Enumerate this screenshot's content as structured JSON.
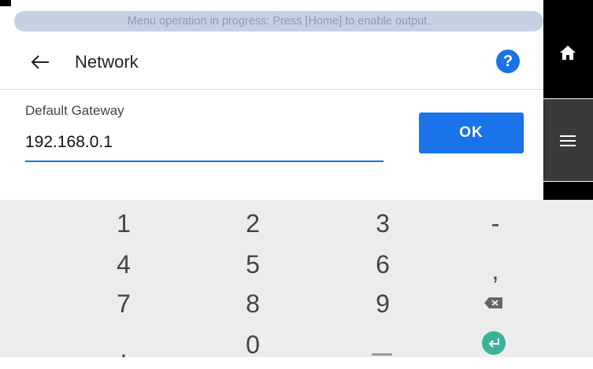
{
  "banner": {
    "text": "Menu operation in progress: Press [Home] to enable output."
  },
  "header": {
    "title": "Network",
    "help_label": "?"
  },
  "field": {
    "label": "Default Gateway",
    "value": "192.168.0.1"
  },
  "ok_button": {
    "label": "OK"
  },
  "keyboard": {
    "keys": [
      "1",
      "2",
      "3",
      "-",
      "4",
      "5",
      "6",
      ",",
      "7",
      "8",
      "9",
      ".",
      "0"
    ],
    "backspace_icon": "backspace-icon",
    "enter_icon": "enter-icon"
  },
  "colors": {
    "accent": "#1a73e8",
    "banner_bg": "#c5d1e3",
    "enter_key": "#3bb39a",
    "keyboard_bg": "#ececec"
  }
}
